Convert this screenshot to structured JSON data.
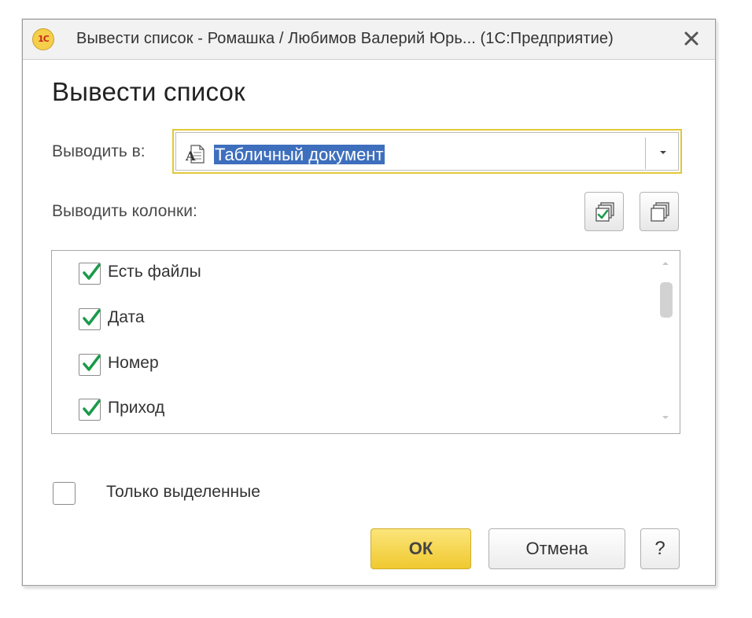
{
  "window": {
    "title": "Вывести список - Ромашка / Любимов Валерий Юрь...  (1С:Предприятие)",
    "logo_text": "1С"
  },
  "heading": "Вывести список",
  "output_to": {
    "label": "Выводить в:",
    "value": "Табличный документ"
  },
  "columns": {
    "label": "Выводить колонки:",
    "items": [
      {
        "label": "Есть файлы",
        "checked": true
      },
      {
        "label": "Дата",
        "checked": true
      },
      {
        "label": "Номер",
        "checked": true
      },
      {
        "label": "Приход",
        "checked": true
      }
    ]
  },
  "only_selected": {
    "label": "Только выделенные",
    "checked": false
  },
  "buttons": {
    "ok": "ОК",
    "cancel": "Отмена",
    "help": "?"
  },
  "colors": {
    "accent_yellow": "#f0c930",
    "selection_blue": "#3e6fbd",
    "check_green": "#1a9a4a"
  }
}
